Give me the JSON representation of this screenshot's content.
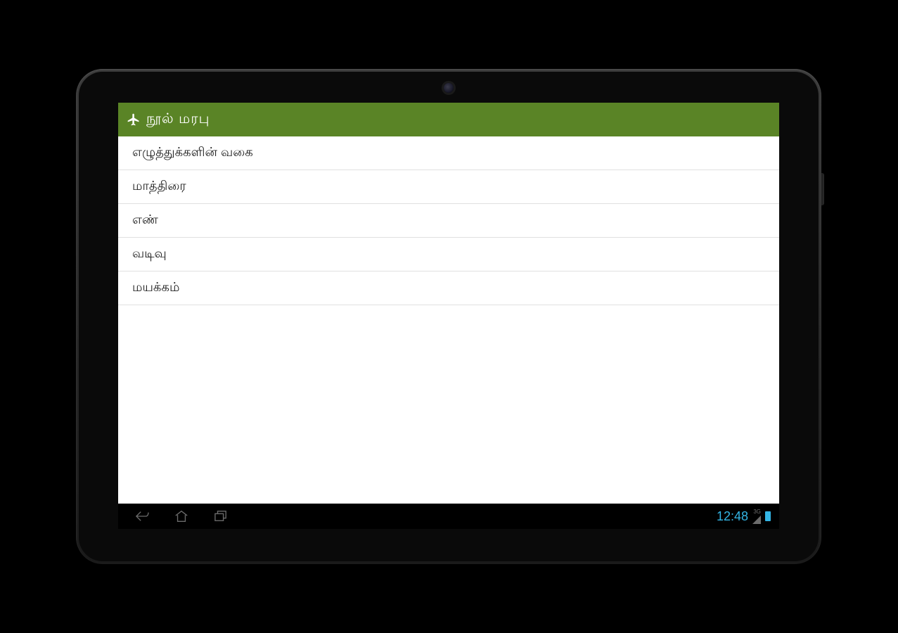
{
  "header": {
    "title": "நூல்   மரபு",
    "icon": "airplane-icon"
  },
  "list": {
    "items": [
      {
        "label": "எழுத்துக்களின்  வகை"
      },
      {
        "label": "மாத்திரை"
      },
      {
        "label": "எண்"
      },
      {
        "label": "வடிவு"
      },
      {
        "label": "மயக்கம்"
      }
    ]
  },
  "navbar": {
    "clock": "12:48",
    "signal_label": "3G"
  }
}
